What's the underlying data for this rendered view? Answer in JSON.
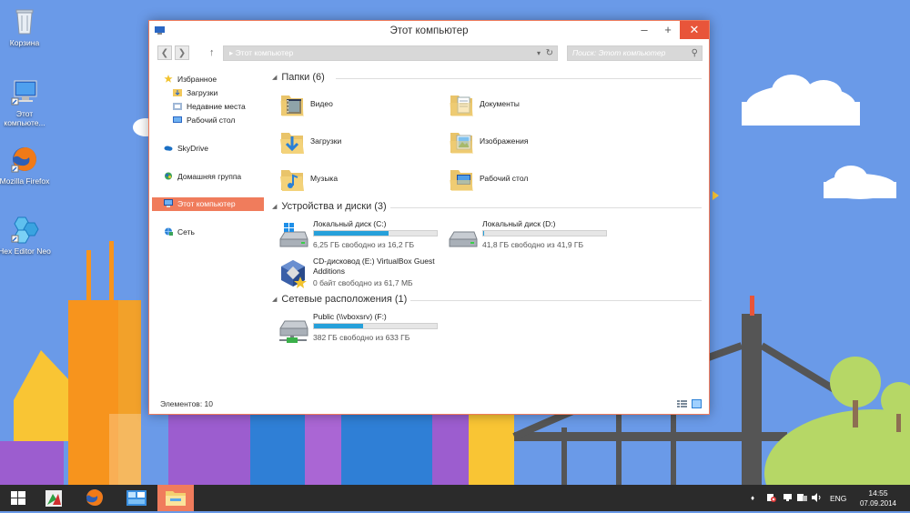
{
  "desktop": {
    "icons": [
      {
        "label": "Корзина"
      },
      {
        "label": "Этот компьюте..."
      },
      {
        "label": "Mozilla Firefox"
      },
      {
        "label": "Hex Editor Neo"
      }
    ]
  },
  "window": {
    "title": "Этот компьютер",
    "controls": {
      "minimize": "–",
      "maximize": "+",
      "close": "✕"
    },
    "address": "Этот компьютер",
    "address_prefix": "▸",
    "search_placeholder": "Поиск: Этот компьютер",
    "nav": {
      "back": "❮",
      "forward": "❯",
      "up": "↑",
      "refresh": "↻",
      "dropdown": "▾",
      "search_icon": "⚲"
    },
    "navpane": {
      "favorites": "Избранное",
      "downloads": "Загрузки",
      "recent": "Недавние места",
      "desktop": "Рабочий стол",
      "skydrive": "SkyDrive",
      "homegroup": "Домашняя группа",
      "this_pc": "Этот компьютер",
      "network": "Сеть"
    },
    "groups": {
      "folders": "Папки (6)",
      "devices": "Устройства и диски (3)",
      "network": "Сетевые расположения (1)"
    },
    "folders": [
      {
        "name": "Видео",
        "icon": "video-folder-icon"
      },
      {
        "name": "Документы",
        "icon": "documents-folder-icon"
      },
      {
        "name": "Загрузки",
        "icon": "downloads-folder-icon"
      },
      {
        "name": "Изображения",
        "icon": "pictures-folder-icon"
      },
      {
        "name": "Музыка",
        "icon": "music-folder-icon"
      },
      {
        "name": "Рабочий стол",
        "icon": "desktop-folder-icon"
      }
    ],
    "drives": [
      {
        "name": "Локальный диск (C:)",
        "free": "6,25 ГБ свободно из 16,2 ГБ",
        "used_fraction": 0.61
      },
      {
        "name": "Локальный диск (D:)",
        "free": "41,8 ГБ свободно из 41,9 ГБ",
        "used_fraction": 0.01
      },
      {
        "name": "CD-дисковод (E:) VirtualBox Guest Additions",
        "free": "0 байт свободно из 61,7 МБ",
        "used_fraction": 1.0
      }
    ],
    "network_locations": [
      {
        "name": "Public (\\\\vboxsrv) (F:)",
        "free": "382 ГБ свободно из 633 ГБ",
        "used_fraction": 0.4
      }
    ],
    "status": "Элементов: 10"
  },
  "taskbar": {
    "lang": "ENG",
    "time": "14:55",
    "date": "07.09.2014"
  },
  "colors": {
    "accent": "#f07c5c",
    "taskbar": "#2b2b2b",
    "sky": "#6a9ae8",
    "bar_fill": "#26a0da"
  }
}
